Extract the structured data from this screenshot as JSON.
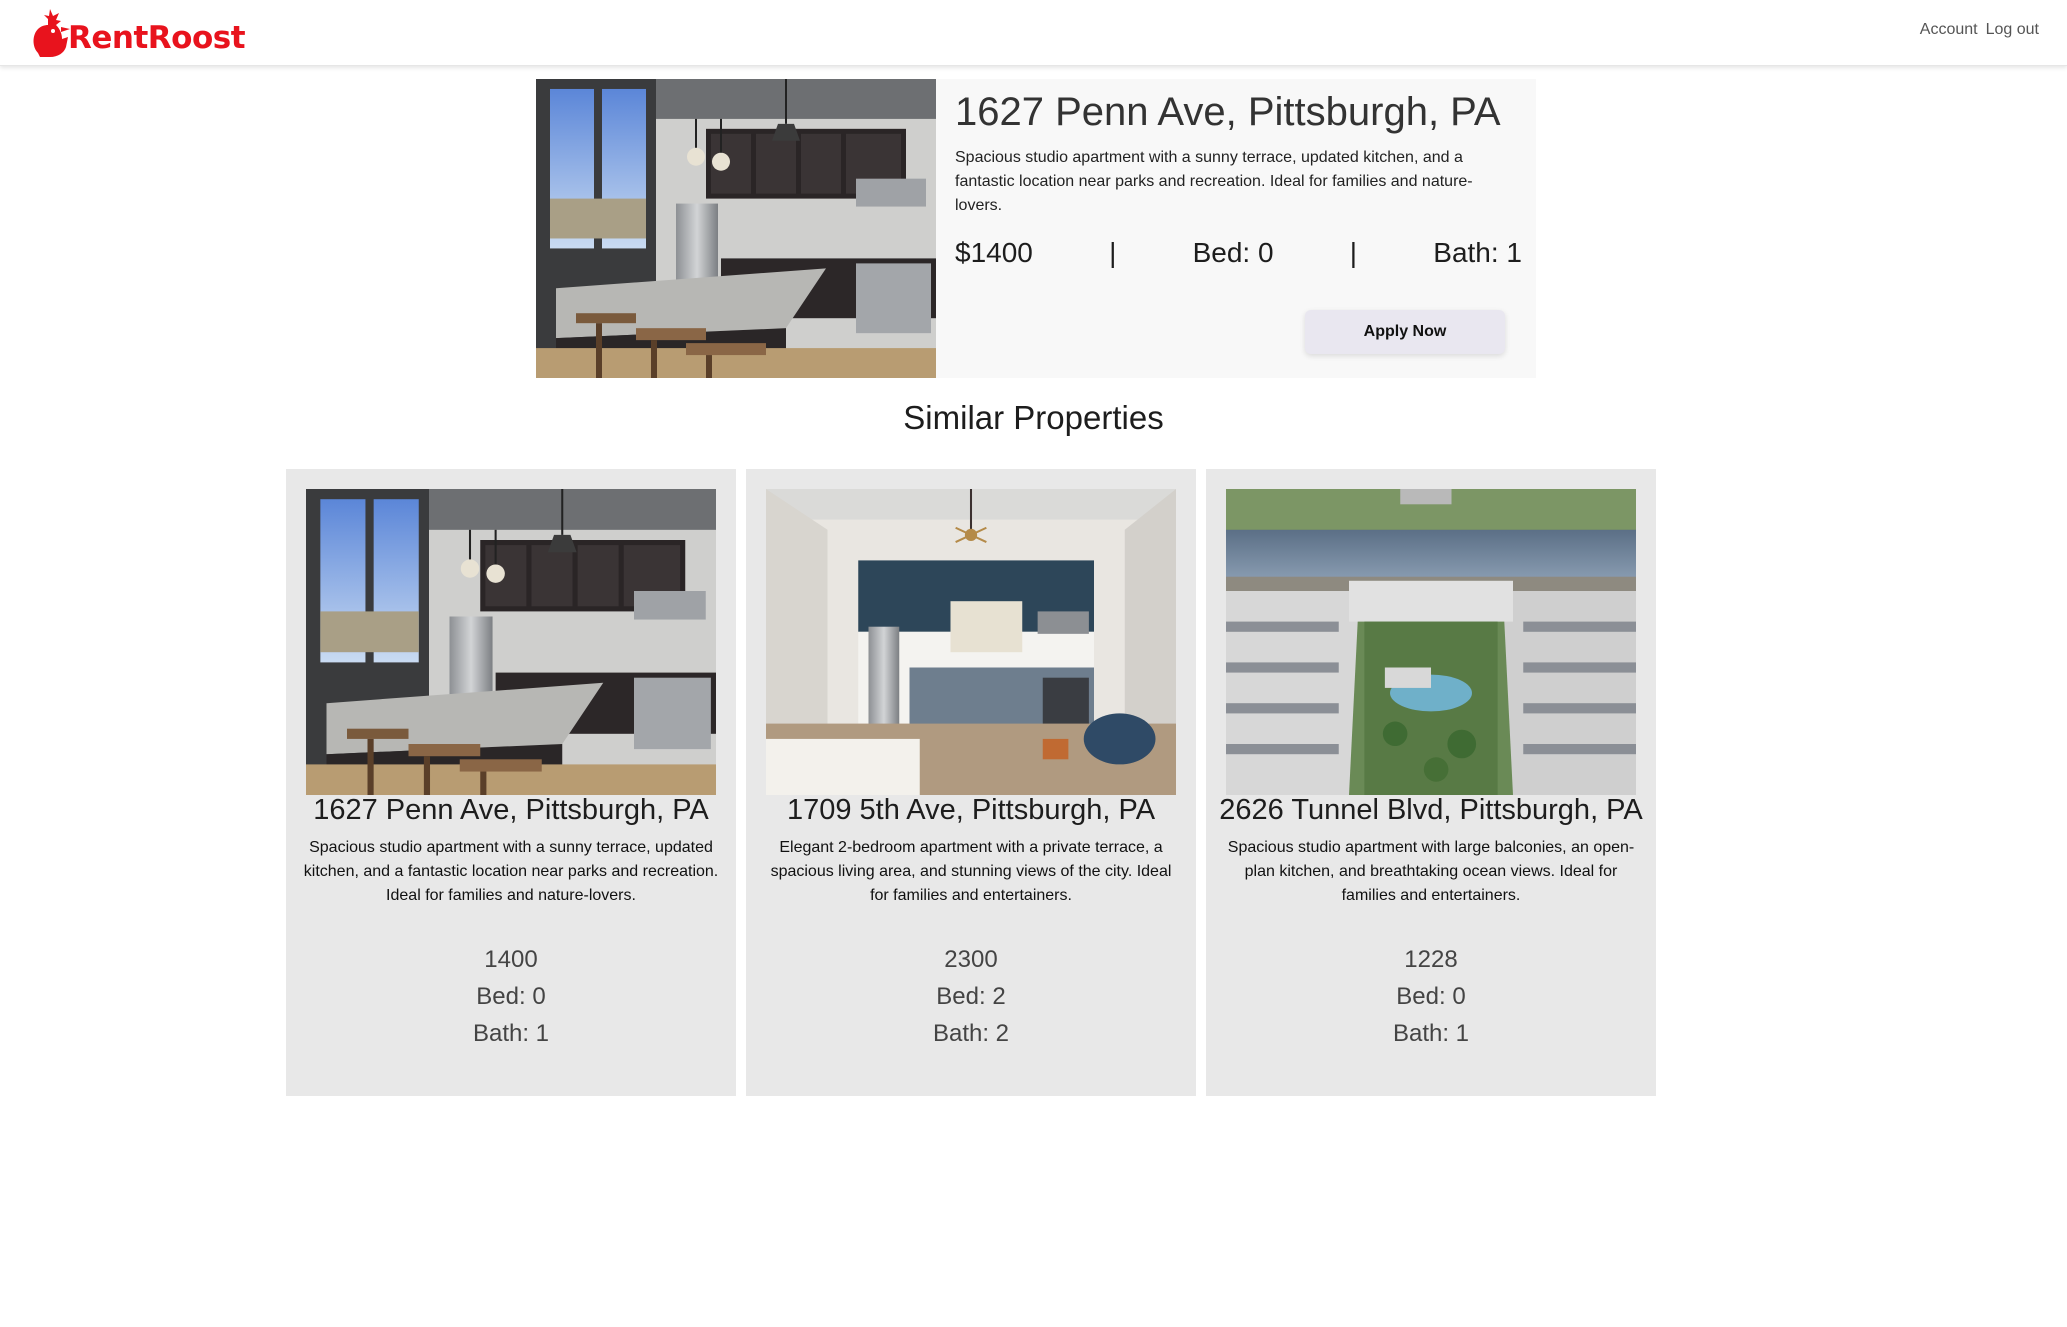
{
  "header": {
    "brand": "RentRoost",
    "nav": {
      "account": "Account",
      "logout": "Log out"
    }
  },
  "colors": {
    "brand_red": "#e8131d",
    "card_bg": "#e8e8e8",
    "button_bg": "#e9e7f0"
  },
  "featured": {
    "image": "kitchen-photo",
    "title": "1627 Penn Ave, Pittsburgh, PA",
    "description": "Spacious studio apartment with a sunny terrace, updated kitchen, and a fantastic location near parks and recreation. Ideal for families and nature-lovers.",
    "price": "$1400",
    "separator": "|",
    "bed": "Bed: 0",
    "bath": "Bath: 1",
    "apply_label": "Apply Now"
  },
  "similar": {
    "heading": "Similar Properties",
    "items": [
      {
        "image": "kitchen-photo",
        "title": "1627 Penn Ave, Pittsburgh, PA",
        "description": "Spacious studio apartment with a sunny terrace, updated kitchen, and a fantastic location near parks and recreation. Ideal for families and nature-lovers.",
        "price": "1400",
        "bed": "Bed: 0",
        "bath": "Bath: 1"
      },
      {
        "image": "studio-interior-photo",
        "title": "1709 5th Ave, Pittsburgh, PA",
        "description": "Elegant 2-bedroom apartment with a private terrace, a spacious living area, and stunning views of the city. Ideal for families and entertainers.",
        "price": "2300",
        "bed": "Bed: 2",
        "bath": "Bath: 2"
      },
      {
        "image": "building-aerial-photo",
        "title": "2626 Tunnel Blvd, Pittsburgh, PA",
        "description": "Spacious studio apartment with large balconies, an open-plan kitchen, and breathtaking ocean views. Ideal for families and entertainers.",
        "price": "1228",
        "bed": "Bed: 0",
        "bath": "Bath: 1"
      }
    ]
  }
}
